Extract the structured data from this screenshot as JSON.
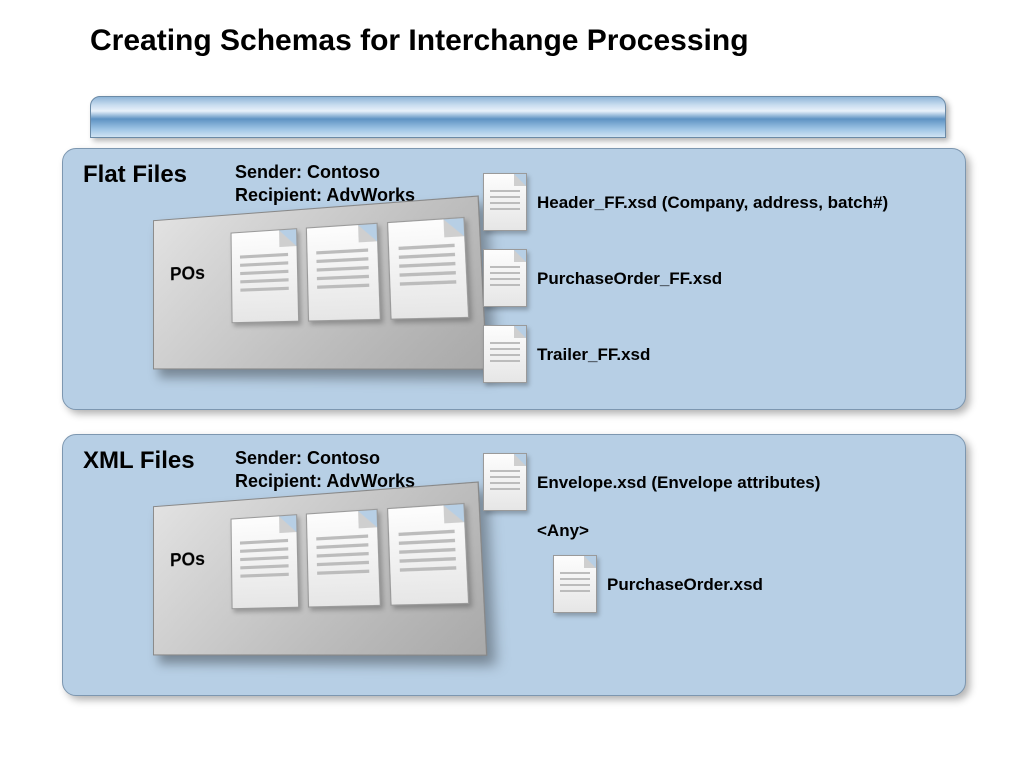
{
  "title": "Creating Schemas for Interchange Processing",
  "panels": {
    "flat": {
      "title": "Flat Files",
      "meta": "Sender: Contoso\nRecipient: AdvWorks",
      "envelopeLabel": "POs",
      "files": [
        {
          "label": "Header_FF.xsd (Company, address, batch#)"
        },
        {
          "label": "PurchaseOrder_FF.xsd"
        },
        {
          "label": "Trailer_FF.xsd"
        }
      ]
    },
    "xml": {
      "title": "XML Files",
      "meta": "Sender: Contoso\nRecipient: AdvWorks",
      "envelopeLabel": "POs",
      "envelopeFile": {
        "label": "Envelope.xsd (Envelope attributes)"
      },
      "anyLabel": "<Any>",
      "childFile": {
        "label": "PurchaseOrder.xsd"
      }
    }
  }
}
